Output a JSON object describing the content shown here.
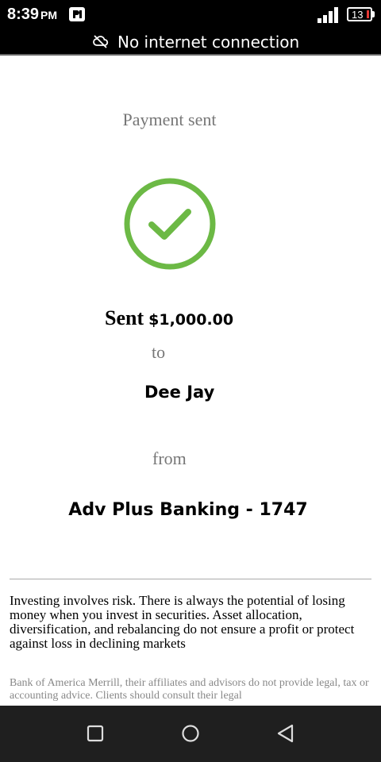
{
  "status_bar": {
    "time": "8:39",
    "ampm": "PM",
    "battery": "13",
    "icons": [
      "app-notification-icon",
      "signal-icon",
      "battery-icon"
    ]
  },
  "offline_banner": {
    "icon": "cloud-off-icon",
    "text": "No internet connection"
  },
  "confirmation": {
    "heading": "Payment sent",
    "status_icon": "check-circle-icon",
    "accent_color": "#6cb945",
    "sent_label": "Sent",
    "amount": "$1,000.00",
    "to_label": "to",
    "recipient": "Dee Jay",
    "from_label": "from",
    "account": "Adv Plus Banking - 1747"
  },
  "disclosures": {
    "investing": "Investing involves risk. There is always the potential of losing money when you invest in securities. Asset allocation, diversification, and rebalancing do not ensure a profit or protect\nagainst loss in declining markets",
    "advisors": "Bank of America Merrill, their affiliates and advisors do not provide legal, tax or accounting advice. Clients should consult their legal"
  },
  "nav_bar": {
    "buttons": [
      "recents-button",
      "home-button",
      "back-button"
    ]
  }
}
